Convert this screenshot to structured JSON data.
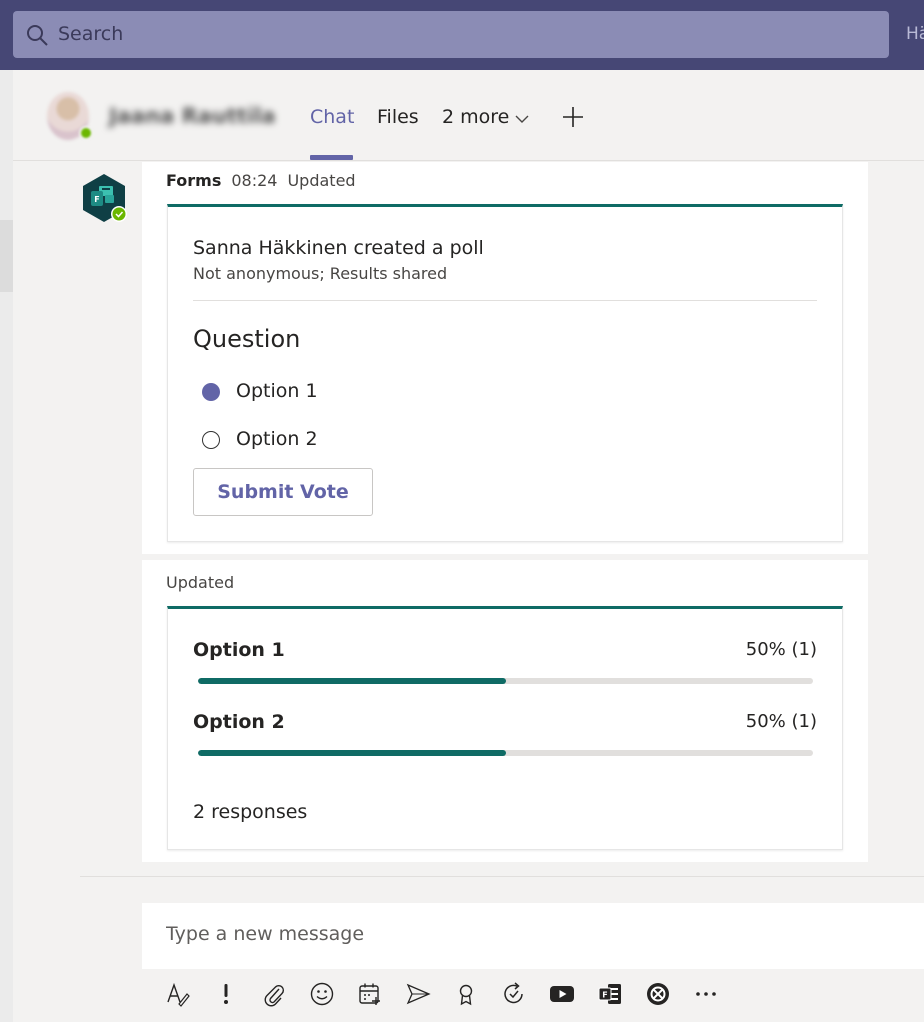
{
  "topbar": {
    "search_placeholder": "Search",
    "right_text": "Hä"
  },
  "header": {
    "contact_name": "Jaana Rauttila",
    "tabs": [
      {
        "label": "Chat",
        "active": true
      },
      {
        "label": "Files",
        "active": false
      },
      {
        "label": "2 more",
        "active": false
      }
    ]
  },
  "message": {
    "sender": "Forms",
    "time": "08:24",
    "edited": "Updated",
    "poll": {
      "title": "Sanna Häkkinen created a poll",
      "subtitle": "Not anonymous; Results shared",
      "question": "Question",
      "options": [
        {
          "label": "Option 1",
          "selected": true
        },
        {
          "label": "Option 2",
          "selected": false
        }
      ],
      "submit_label": "Submit Vote"
    }
  },
  "results": {
    "updated_label": "Updated",
    "rows": [
      {
        "label": "Option 1",
        "percent_text": "50% (1)",
        "fraction": 0.5
      },
      {
        "label": "Option 2",
        "percent_text": "50% (1)",
        "fraction": 0.5
      }
    ],
    "responses_text": "2 responses"
  },
  "compose": {
    "placeholder": "Type a new message"
  },
  "colors": {
    "topbar": "#464775",
    "accent": "#6264a7",
    "poll_teal": "#0f6b65"
  },
  "toolbar_icons": [
    "format-icon",
    "important-icon",
    "attach-icon",
    "emoji-icon",
    "schedule-meeting-icon",
    "stream-icon",
    "praise-icon",
    "loop-icon",
    "youtube-icon",
    "forms-icon",
    "app-icon",
    "more-icon"
  ]
}
